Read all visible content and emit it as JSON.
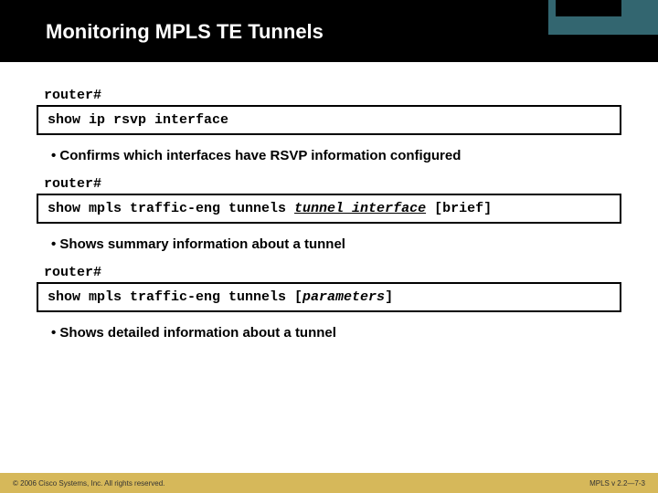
{
  "header": {
    "title": "Monitoring MPLS TE Tunnels"
  },
  "block1": {
    "prompt": "router#",
    "cmd": "show ip rsvp interface",
    "bullet": "Confirms which interfaces have RSVP information configured"
  },
  "block2": {
    "prompt": "router#",
    "cmd_pre": "show mpls traffic-eng tunnels ",
    "cmd_var": "tunnel_interface",
    "cmd_post": " [brief]",
    "bullet": "Shows summary information about a tunnel"
  },
  "block3": {
    "prompt": "router#",
    "cmd_pre": "show mpls traffic-eng tunnels [",
    "cmd_param": "parameters",
    "cmd_post": "]",
    "bullet": "Shows detailed information about a tunnel"
  },
  "footer": {
    "left": "© 2006 Cisco Systems, Inc. All rights reserved.",
    "right": "MPLS v 2.2—7-3"
  }
}
